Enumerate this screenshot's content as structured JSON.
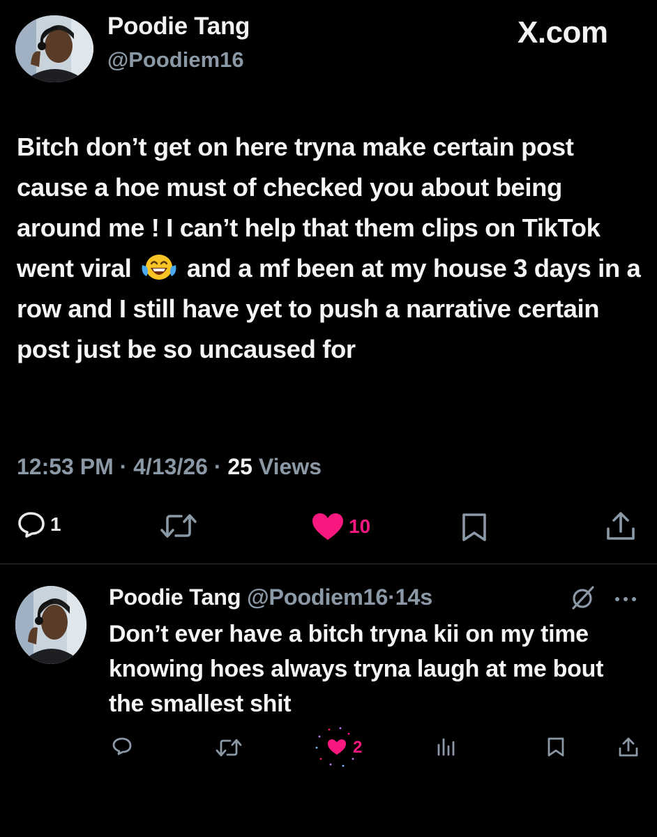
{
  "brand": {
    "label": "X.com"
  },
  "tweet": {
    "author_name": "Poodie Tang",
    "author_handle": "@Poodiem16",
    "text_before_emoji": "Bitch don’t get on here tryna make certain post cause a hoe must of checked you about being around me ! I can’t help that them clips on TikTok went viral",
    "emoji": "face-with-tears-of-joy",
    "text_after_emoji": "and a mf been at my house 3 days in a row and I still have yet to push a narrative certain post just be so uncaused for",
    "time": "12:53 PM",
    "date": "4/13/26",
    "separator": "·",
    "views_count": "25",
    "views_label": "Views",
    "reply_count": "1",
    "like_count": "10",
    "icons": [
      "reply-icon",
      "retweet-icon",
      "heart-icon",
      "bookmark-icon",
      "share-icon"
    ],
    "colors": {
      "like": "#f91880",
      "muted": "#8b98a5",
      "text": "#e7e9ea"
    }
  },
  "reply": {
    "author_name": "Poodie Tang",
    "author_handle": "@Poodiem16",
    "separator": "·",
    "age": "14s",
    "text": "Don’t ever have a bitch tryna kii on my time knowing hoes always tryna laugh at me bout the smallest shit",
    "like_count": "2",
    "icons": [
      "grok-icon",
      "more-icon",
      "reply-icon",
      "retweet-icon",
      "heart-icon",
      "analytics-icon",
      "bookmark-icon",
      "share-icon"
    ]
  }
}
